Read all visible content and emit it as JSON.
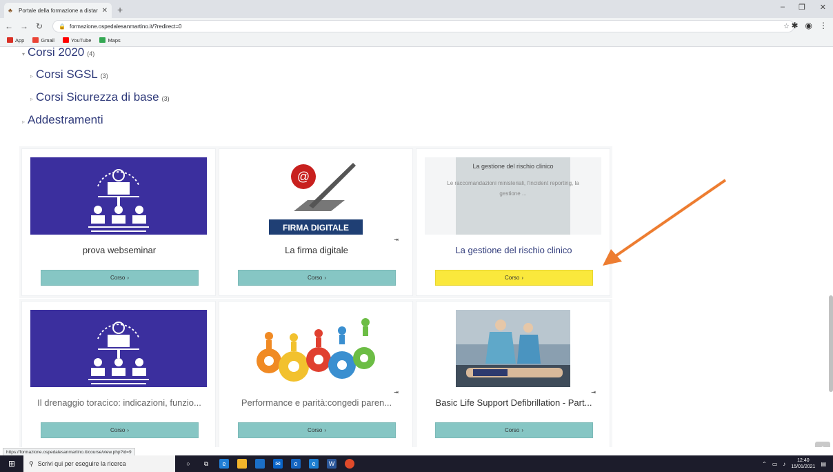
{
  "browser": {
    "tab_title": "Portale della formazione a distar",
    "new_tab": "+",
    "url": "formazione.ospedalesanmartino.it/?redirect=0",
    "bookmarks": [
      {
        "label": "App",
        "color": "#d93025"
      },
      {
        "label": "Gmail",
        "color": "#ea4335"
      },
      {
        "label": "YouTube",
        "color": "#ff0000"
      },
      {
        "label": "Maps",
        "color": "#34a853"
      }
    ],
    "status_url": "https://formazione.ospedalesanmartino.it/course/view.php?id=9"
  },
  "tree": [
    {
      "label": "Corsi 2020",
      "count": "(4)",
      "expanded": true
    },
    {
      "label": "Corsi SGSL",
      "count": "(3)"
    },
    {
      "label": "Corsi Sicurezza di base",
      "count": "(3)"
    },
    {
      "label": "Addestramenti",
      "count": ""
    }
  ],
  "cards": [
    {
      "name": "prova webseminar",
      "button": "Corso",
      "image": "webinar-icon",
      "style": "normal",
      "enrol": ""
    },
    {
      "name": "La firma digitale",
      "button": "Corso",
      "image": "firma-digitale",
      "style": "normal",
      "enrol": "⇥",
      "image_text": "FIRMA DIGITALE"
    },
    {
      "name": "La gestione del rischio clinico",
      "button": "Corso",
      "image": "rischio-clinico",
      "style": "link",
      "enrol": "",
      "highlight": true,
      "image_title": "La gestione del rischio clinico",
      "image_sub": "Le raccomandazioni ministeriali, l'incident reporting, la gestione ..."
    },
    {
      "name": "Il drenaggio toracico: indicazioni, funzio...",
      "button": "Corso",
      "image": "webinar-icon",
      "style": "muted",
      "enrol": ""
    },
    {
      "name": "Performance e parità:congedi paren...",
      "button": "Corso",
      "image": "gears",
      "style": "muted",
      "enrol": "⇥"
    },
    {
      "name": "Basic Life Support Defibrillation - Part...",
      "button": "Corso",
      "image": "bls",
      "style": "normal",
      "enrol": "⇥"
    }
  ],
  "taskbar": {
    "search_placeholder": "Scrivi qui per eseguire la ricerca",
    "time": "12:40",
    "date": "15/01/2021"
  },
  "colors": {
    "button": "#86c6c4",
    "button_highlight": "#fae83c",
    "link": "#2f3a7a",
    "arrow": "#ed7d31",
    "webinar_bg": "#3b2f9e"
  }
}
